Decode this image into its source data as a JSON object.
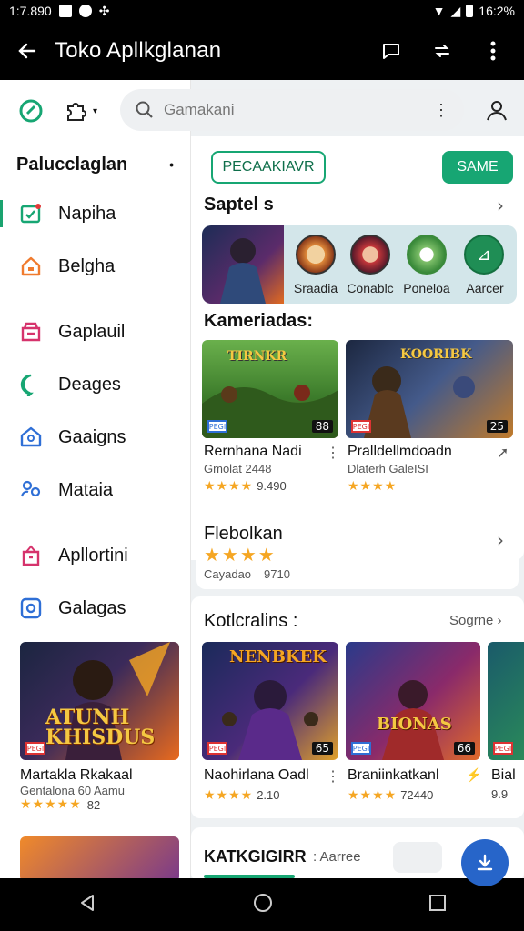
{
  "status_bar": {
    "left_text": "1:7.890",
    "time": "16:2%"
  },
  "app_bar": {
    "title": "Toko Apllkglanan"
  },
  "search": {
    "placeholder": "Gamakani"
  },
  "sidebar": {
    "header": "Palucclaglan",
    "items": [
      {
        "label": "Napiha",
        "icon": "checklist-icon",
        "color": "#17a673"
      },
      {
        "label": "Belgha",
        "icon": "home-icon",
        "color": "#f07b2e"
      },
      {
        "label": "Gaplauil",
        "icon": "store-icon",
        "color": "#d6336c"
      },
      {
        "label": "Deages",
        "icon": "chat-bubble-icon",
        "color": "#17a673"
      },
      {
        "label": "Gaaigns",
        "icon": "house-icon",
        "color": "#2f6fd6"
      },
      {
        "label": "Mataia",
        "icon": "people-icon",
        "color": "#2f6fd6"
      },
      {
        "label": "Apllortini",
        "icon": "bag-icon",
        "color": "#d6336c"
      },
      {
        "label": "Galagas",
        "icon": "target-icon",
        "color": "#2f6fd6"
      }
    ],
    "card1": {
      "title": "Martakla Rkakaal",
      "subtitle": "Gentalona 60 Aamu",
      "rating": "★★★★★",
      "score": "82",
      "art_text": "ATUNH KHISDUS"
    }
  },
  "top_pills": {
    "left": "PECAAKIAVR",
    "right": "SAME"
  },
  "section_apps": {
    "title": "Saptel s",
    "apps": [
      {
        "label": "Sraadia",
        "color": "#e08a3a"
      },
      {
        "label": "Conablc",
        "color": "#c4363a"
      },
      {
        "label": "Poneloa",
        "color": "#5aa84e"
      },
      {
        "label": "Aarcer",
        "color": "#1f8e55"
      }
    ]
  },
  "section_kategori": {
    "title": "Kameriadas:",
    "games": [
      {
        "name": "Rernhana Nadi",
        "dev": "Gmolat 2448",
        "rating": "★★★★",
        "score": "9.490",
        "badge": "88",
        "art_text": "TIRNKR"
      },
      {
        "name": "Pralldellmdoadn",
        "dev": "Dlaterh GaleISI",
        "rating": "★★★★",
        "score": "",
        "badge": "25",
        "art_text": "KOORIBK"
      }
    ]
  },
  "highlight": {
    "title": "Flebolkan",
    "rating": "★★★★",
    "dev": "Cayadao",
    "score": "9710"
  },
  "section_trending": {
    "title": "Kotlcralins :",
    "see_more": "Sogrne",
    "games": [
      {
        "name": "Naohirlana Oadl",
        "rating": "★★★★",
        "score": "2.10",
        "badge": "65",
        "art_text": "NENBKEK"
      },
      {
        "name": "Braniinkatkanl",
        "rating": "★★★★",
        "score": "72440",
        "badge": "66",
        "art_text": "BIONAS"
      },
      {
        "name": "Bial",
        "rating": "",
        "score": "9.9",
        "badge": "",
        "art_text": ""
      }
    ]
  },
  "bottom_row": {
    "title": "KATKGIGIRR",
    "label": "Aarree"
  }
}
